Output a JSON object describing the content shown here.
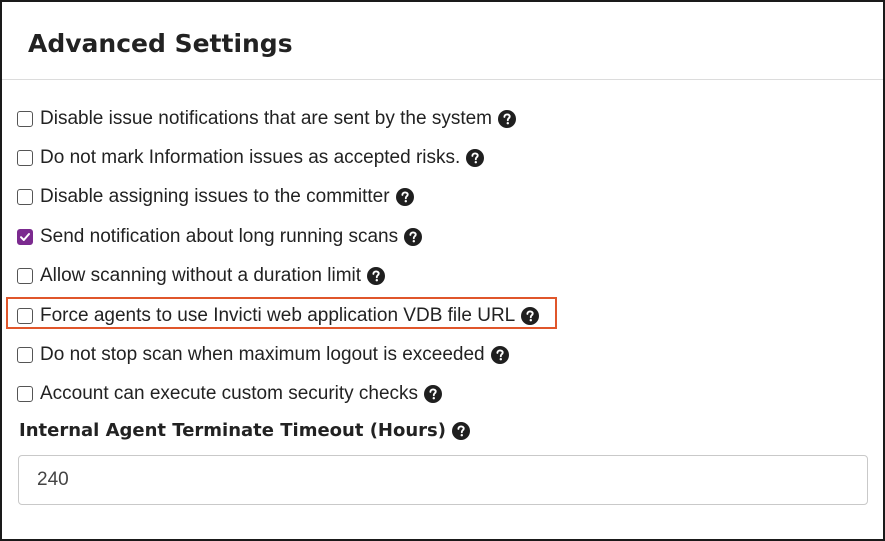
{
  "panel": {
    "title": "Advanced Settings"
  },
  "options": [
    {
      "label": "Disable issue notifications that are sent by the system",
      "checked": false
    },
    {
      "label": "Do not mark Information issues as accepted risks.",
      "checked": false
    },
    {
      "label": "Disable assigning issues to the committer",
      "checked": false
    },
    {
      "label": "Send notification about long running scans",
      "checked": true
    },
    {
      "label": "Allow scanning without a duration limit",
      "checked": false
    },
    {
      "label": "Force agents to use Invicti web application VDB file URL",
      "checked": false,
      "highlighted": true
    },
    {
      "label": "Do not stop scan when maximum logout is exceeded",
      "checked": false
    },
    {
      "label": "Account can execute custom security checks",
      "checked": false
    }
  ],
  "timeout": {
    "label": "Internal Agent Terminate Timeout (Hours)",
    "value": "240"
  },
  "icons": {
    "help": "question-circle-icon",
    "check": "checkmark-icon"
  },
  "colors": {
    "checked_accent": "#7b2a8f",
    "highlight_border": "#e0562b",
    "text": "#222222"
  }
}
